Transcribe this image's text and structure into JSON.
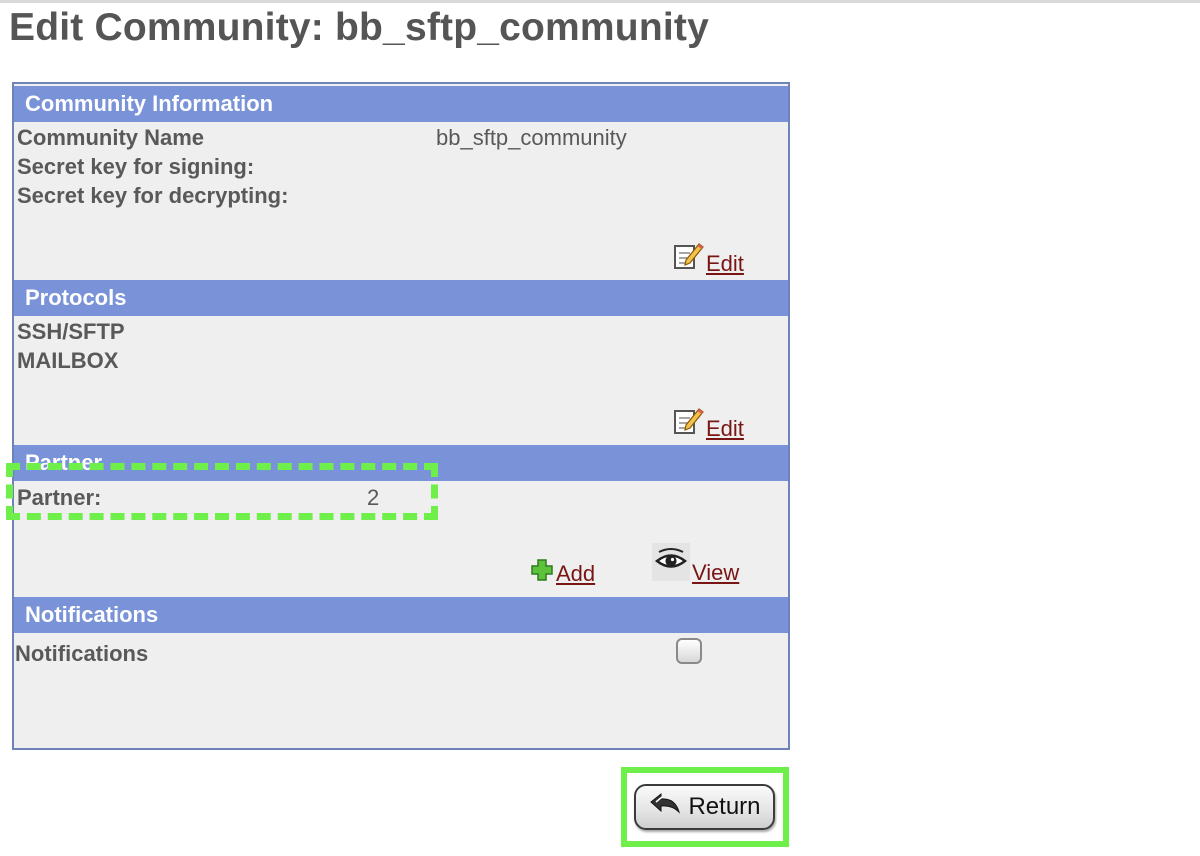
{
  "page": {
    "title": "Edit Community: bb_sftp_community"
  },
  "community_info": {
    "header": "Community Information",
    "name_label": "Community Name",
    "name_value": "bb_sftp_community",
    "signing_label": "Secret key for signing:",
    "decrypting_label": "Secret key for decrypting:",
    "edit_label": "Edit",
    "edit_icon": "edit-note-icon"
  },
  "protocols": {
    "header": "Protocols",
    "items": [
      "SSH/SFTP",
      "MAILBOX"
    ],
    "edit_label": "Edit",
    "edit_icon": "edit-note-icon"
  },
  "partner": {
    "header": "Partner",
    "label": "Partner:",
    "count": "2",
    "add_label": "Add",
    "add_icon": "plus-icon",
    "view_label": "View",
    "view_icon": "eye-icon"
  },
  "notifications": {
    "header": "Notifications",
    "label": "Notifications",
    "checked": false
  },
  "footer": {
    "return_label": "Return",
    "return_icon": "return-arrow-icon"
  },
  "colors": {
    "section_header": "#7a93d8",
    "panel_background": "#efefef",
    "link": "#7a1515",
    "highlight": "#6fef4a"
  }
}
